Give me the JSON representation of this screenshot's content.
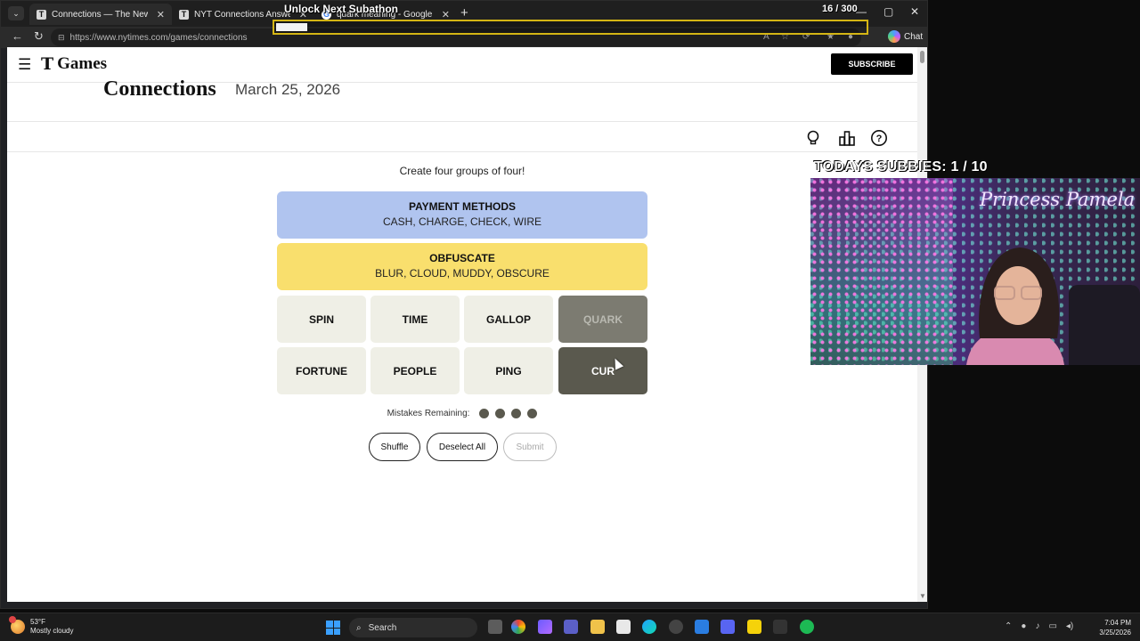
{
  "browser": {
    "tabs": [
      {
        "label": "Connections — The New York Times",
        "favicon": "T"
      },
      {
        "label": "NYT Connections Answers for Ma",
        "favicon": "T"
      },
      {
        "label": "quark meaning - Google Search",
        "favicon": "G"
      }
    ],
    "url": "https://www.nytimes.com/games/connections",
    "chat_label": "Chat"
  },
  "overlay": {
    "title": "Unlock Next Subathon",
    "count": "16 / 300",
    "progress_fraction": 0.053
  },
  "header": {
    "logo_t": "T",
    "logo_text": "Games",
    "subscribe_label": "SUBSCRIBE"
  },
  "game": {
    "title": "Connections",
    "date": "March 25, 2026",
    "instructions": "Create four groups of four!",
    "solved_groups": [
      {
        "name": "PAYMENT METHODS",
        "words": "CASH, CHARGE, CHECK, WIRE",
        "color": "#b0c4ef"
      },
      {
        "name": "OBFUSCATE",
        "words": "BLUR, CLOUD, MUDDY, OBSCURE",
        "color": "#f9df6d"
      }
    ],
    "cards": [
      {
        "word": "SPIN",
        "state": "normal"
      },
      {
        "word": "TIME",
        "state": "normal"
      },
      {
        "word": "GALLOP",
        "state": "normal"
      },
      {
        "word": "QUARK",
        "state": "selected"
      },
      {
        "word": "FORTUNE",
        "state": "normal"
      },
      {
        "word": "PEOPLE",
        "state": "normal"
      },
      {
        "word": "PING",
        "state": "normal"
      },
      {
        "word": "CUR",
        "state": "selected"
      }
    ],
    "mistakes_label": "Mistakes Remaining:",
    "mistakes_remaining": 4,
    "buttons": {
      "shuffle": "Shuffle",
      "deselect": "Deselect All",
      "submit": "Submit"
    }
  },
  "stream": {
    "subbies": "TODAYS SUBBIES:  1 / 10",
    "webcam_name": "Princess Pamela"
  },
  "taskbar": {
    "weather_temp": "53°F",
    "weather_desc": "Mostly cloudy",
    "search_label": "Search",
    "time": "7:04 PM",
    "date": "3/25/2026"
  },
  "colors": {
    "card_bg": "#efefe6",
    "card_selected": "#5a594e",
    "blue_group": "#b0c4ef",
    "yellow_group": "#f9df6d",
    "overlay_accent": "#d4b514"
  }
}
